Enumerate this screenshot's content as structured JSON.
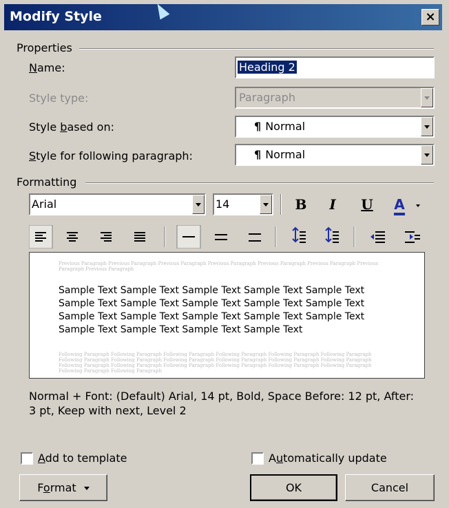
{
  "window": {
    "title": "Modify Style",
    "close_label": "×"
  },
  "properties": {
    "group_label": "Properties",
    "name_label_u": "N",
    "name_label_rest": "ame:",
    "name_value": "Heading 2",
    "style_type_label": "Style type:",
    "style_type_value": "Paragraph",
    "based_on_label_pre": "Style ",
    "based_on_label_u": "b",
    "based_on_label_post": "ased on:",
    "based_on_value": "Normal",
    "following_label_u": "S",
    "following_label_rest": "tyle for following paragraph:",
    "following_value": "Normal",
    "pilcrow": "¶"
  },
  "formatting": {
    "group_label": "Formatting",
    "font": "Arial",
    "size": "14",
    "bold": "B",
    "italic": "I",
    "underline": "U",
    "font_color": "A",
    "font_color_hex": "#1f2fa0"
  },
  "preview": {
    "previous_text": "Previous Paragraph Previous Paragraph Previous Paragraph Previous Paragraph Previous Paragraph Previous Paragraph Previous Paragraph Previous Paragraph",
    "sample_text": "Sample Text Sample Text Sample Text Sample Text Sample Text Sample Text Sample Text Sample Text Sample Text Sample Text Sample Text Sample Text Sample Text Sample Text Sample Text Sample Text Sample Text Sample Text Sample Text",
    "following_text": "Following Paragraph Following Paragraph Following Paragraph Following Paragraph Following Paragraph Following Paragraph Following Paragraph Following Paragraph Following Paragraph Following Paragraph Following Paragraph Following Paragraph Following Paragraph Following Paragraph Following Paragraph Following Paragraph Following Paragraph Following Paragraph Following Paragraph Following Paragraph"
  },
  "description": "Normal + Font: (Default) Arial, 14 pt, Bold, Space Before:  12 pt, After:  3 pt, Keep with next, Level 2",
  "footer": {
    "add_template_u": "A",
    "add_template_rest": "dd to template",
    "auto_update_pre": "A",
    "auto_update_u": "u",
    "auto_update_rest": "tomatically update",
    "format_pre": "F",
    "format_u": "o",
    "format_rest": "rmat",
    "ok_label": "OK",
    "cancel_label": "Cancel"
  }
}
